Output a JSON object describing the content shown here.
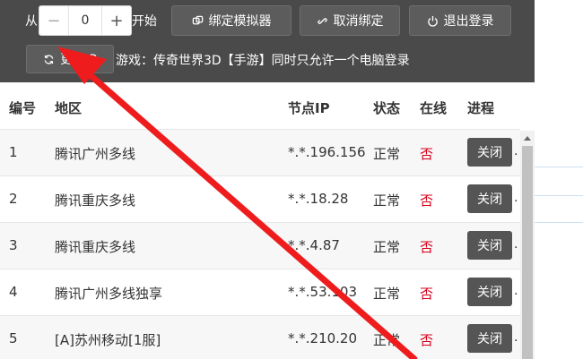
{
  "toolbar": {
    "from_label": "从",
    "stepper_value": "0",
    "minus": "−",
    "plus": "+",
    "start_label": "开始",
    "bind_label": "绑定模拟器",
    "unbind_label": "取消绑定",
    "logout_label": "退出登录",
    "change_ip_label": "更换IP"
  },
  "notice": "游戏：传奇世界3D【手游】同时只允许一个电脑登录",
  "table": {
    "headers": {
      "no": "编号",
      "area": "地区",
      "ip": "节点IP",
      "status": "状态",
      "online": "在线",
      "process": "进程"
    },
    "rows": [
      {
        "no": "1",
        "area": "腾讯广州多线",
        "ip": "*.*.196.156",
        "status": "正常",
        "online": "否",
        "action": "关闭"
      },
      {
        "no": "2",
        "area": "腾讯重庆多线",
        "ip": "*.*.18.28",
        "status": "正常",
        "online": "否",
        "action": "关闭"
      },
      {
        "no": "3",
        "area": "腾讯重庆多线",
        "ip": "*.*.4.87",
        "status": "正常",
        "online": "否",
        "action": "关闭"
      },
      {
        "no": "4",
        "area": "腾讯广州多线独享",
        "ip": "*.*.53.103",
        "status": "正常",
        "online": "否",
        "action": "关闭"
      },
      {
        "no": "5",
        "area": "[A]苏州移动[1服]",
        "ip": "*.*.210.20",
        "status": "正常",
        "online": "否",
        "action": "关闭"
      }
    ]
  },
  "colors": {
    "toolbar_bg": "#4a4a4a",
    "button_bg": "#5c5c5c",
    "offline_red": "#d9001b",
    "annotation_arrow": "#ee1c1c"
  },
  "icons": {
    "bind": "link-chain-icon",
    "unbind": "unlink-icon",
    "logout": "power-icon",
    "change_ip": "refresh-icon"
  }
}
